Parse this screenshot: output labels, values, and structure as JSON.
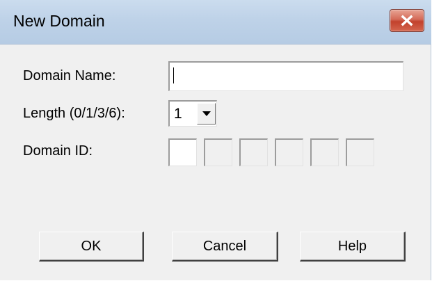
{
  "window": {
    "title": "New Domain"
  },
  "form": {
    "domain_name_label": "Domain Name:",
    "domain_name_value": "",
    "length_label": "Length (0/1/3/6):",
    "length_value": "1",
    "domain_id_label": "Domain ID:",
    "domain_id_fields": [
      "",
      "",
      "",
      "",
      "",
      ""
    ],
    "domain_id_enabled_count": 1
  },
  "buttons": {
    "ok": "OK",
    "cancel": "Cancel",
    "help": "Help"
  },
  "icons": {
    "close": "close-icon",
    "dropdown": "chevron-down-icon"
  },
  "colors": {
    "titlebar": "#bed2e8",
    "close_button": "#c2412c",
    "dialog_background": "#f0f0f0"
  }
}
